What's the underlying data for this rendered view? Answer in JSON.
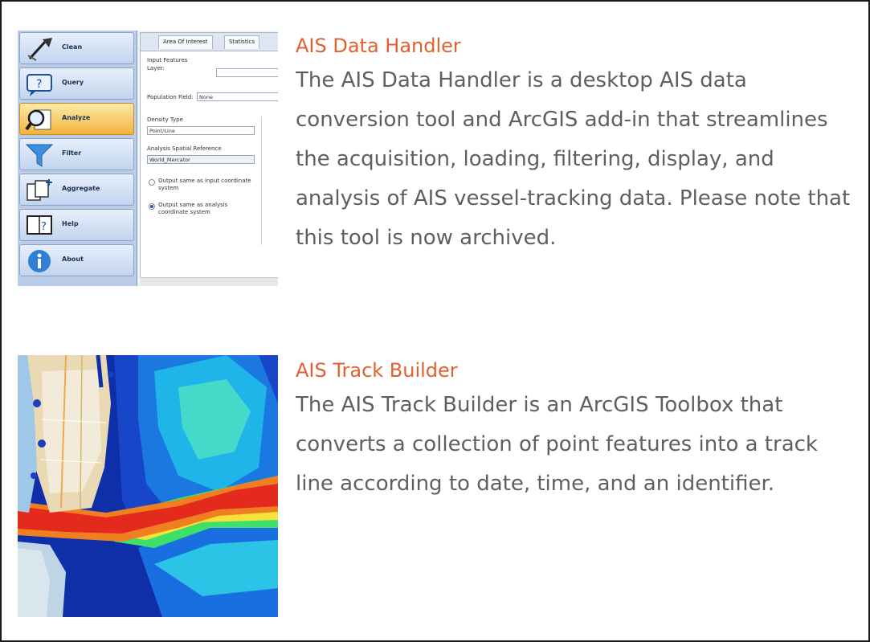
{
  "items": [
    {
      "title": "AIS Data Handler",
      "description": "The AIS Data Handler is a desktop AIS data conversion tool and ArcGIS add-in that streamlines the acquisition, loading, filtering, display, and analysis of AIS vessel-tracking data. Please note that this tool is now archived.",
      "thumbnail": {
        "sidebar": [
          {
            "label": "Clean",
            "icon": "broom-icon"
          },
          {
            "label": "Query",
            "icon": "query-icon"
          },
          {
            "label": "Analyze",
            "icon": "magnifier-icon"
          },
          {
            "label": "Filter",
            "icon": "funnel-icon"
          },
          {
            "label": "Aggregate",
            "icon": "aggregate-icon"
          },
          {
            "label": "Help",
            "icon": "book-icon"
          },
          {
            "label": "About",
            "icon": "info-icon"
          }
        ],
        "active_button": "Analyze",
        "tabs": [
          "Area Of Interest",
          "Statistics"
        ],
        "panel": {
          "input_features": "Input Features",
          "layer_label": "Layer:",
          "population_field_label": "Population Field:",
          "population_field_value": "None",
          "density_type_label": "Density Type",
          "density_type_value": "Point/Line",
          "spatial_reference_label": "Analysis Spatial Reference",
          "spatial_reference_value": "World_Mercator",
          "option_input": "Output same as input coordinate system",
          "option_analysis": "Output same as analysis coordinate system"
        }
      }
    },
    {
      "title": "AIS Track Builder",
      "description": "The AIS Track Builder is an ArcGIS Toolbox that converts a collection of point features into a track line according to date, time, and an identifier."
    }
  ],
  "colors": {
    "title": "#e2602f",
    "text": "#5f5f5f",
    "border": "#1a1a1a",
    "active_button": "#f3b33d"
  }
}
